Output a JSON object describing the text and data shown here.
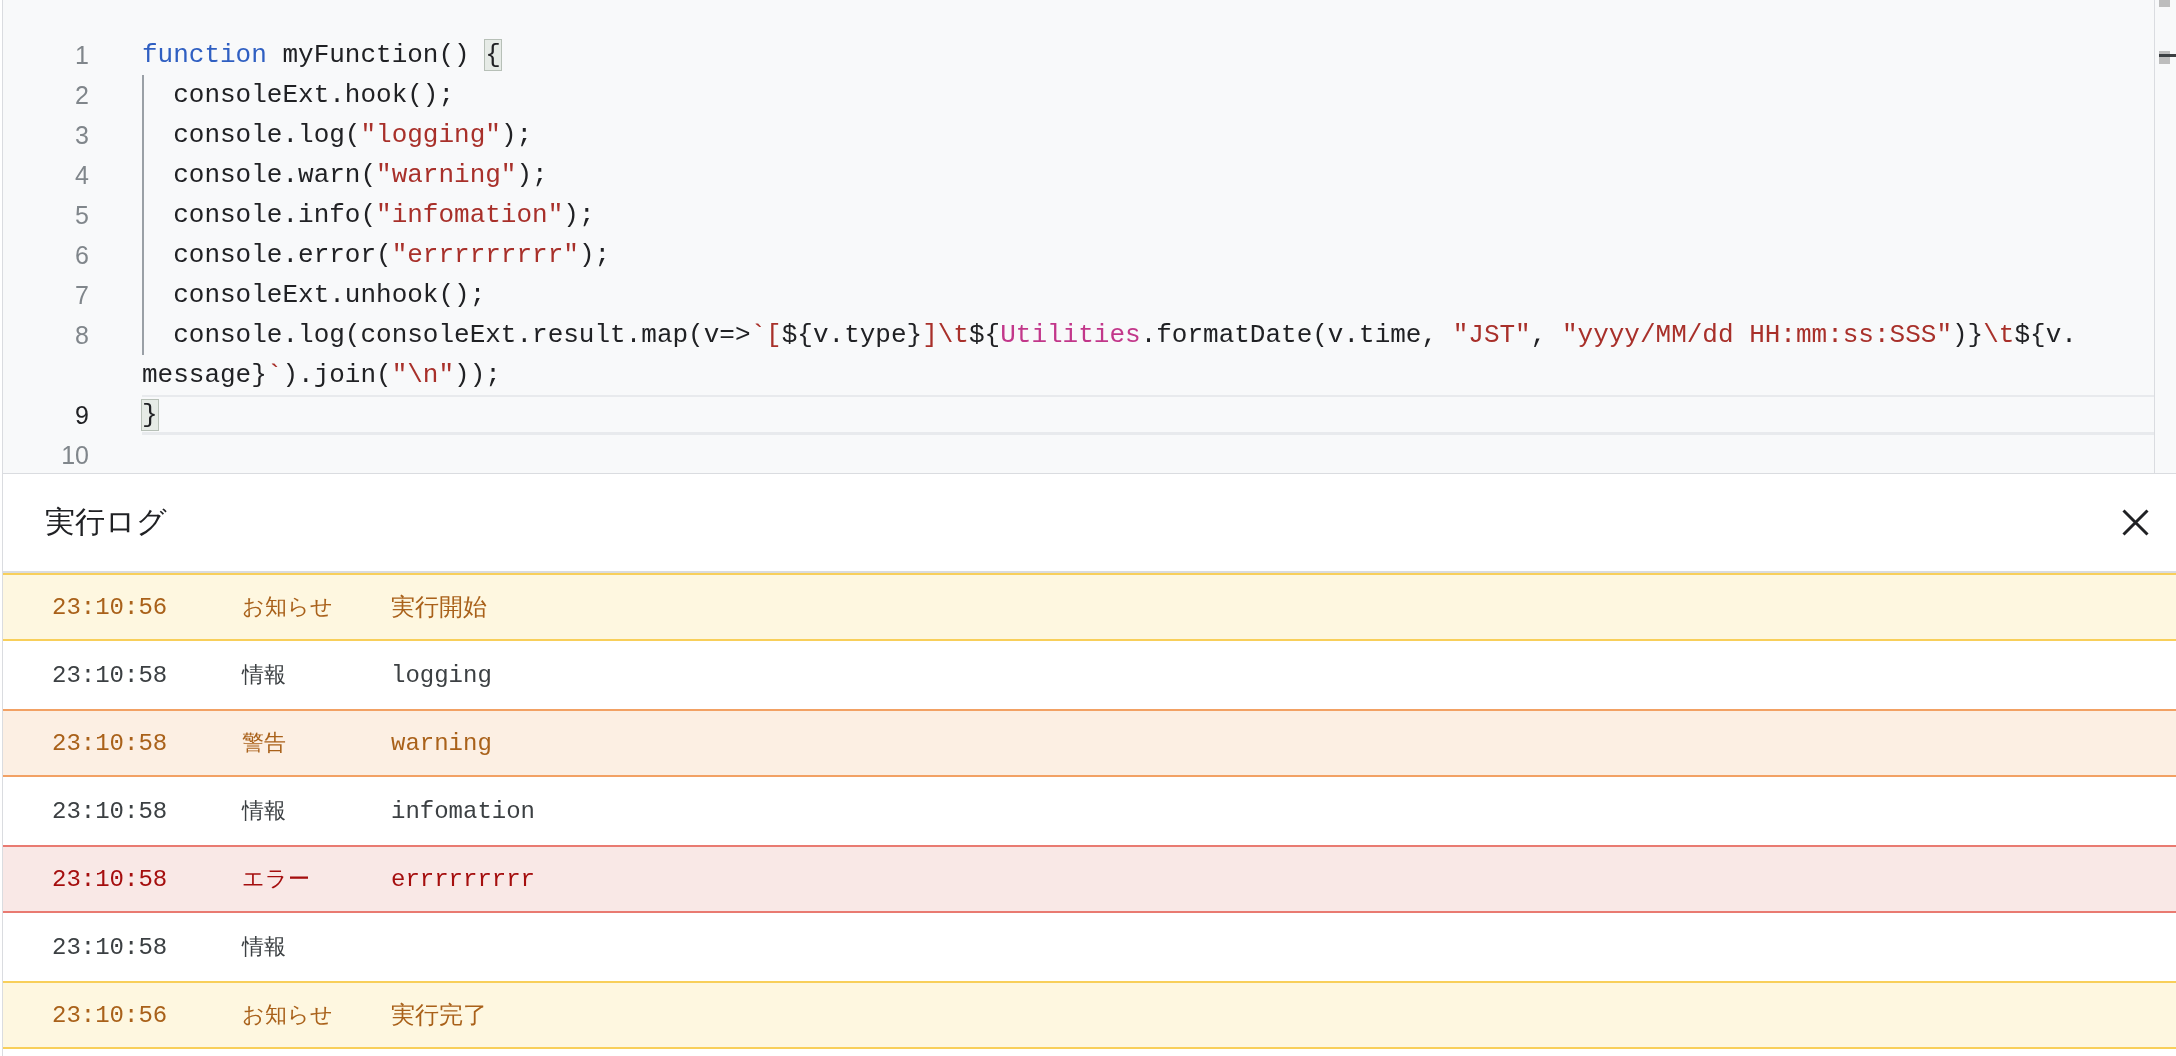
{
  "editor": {
    "lines": [
      {
        "number": "1",
        "current": false,
        "indented": false,
        "tokens": [
          {
            "kind": "keyword",
            "text": "function"
          },
          {
            "kind": "plain",
            "text": " myFunction() "
          },
          {
            "kind": "matched_bracket",
            "text": "{"
          }
        ]
      },
      {
        "number": "2",
        "current": false,
        "indented": true,
        "tokens": [
          {
            "kind": "plain",
            "text": "  consoleExt.hook();"
          }
        ]
      },
      {
        "number": "3",
        "current": false,
        "indented": true,
        "tokens": [
          {
            "kind": "plain",
            "text": "  console.log("
          },
          {
            "kind": "string",
            "text": "\"logging\""
          },
          {
            "kind": "plain",
            "text": ");"
          }
        ]
      },
      {
        "number": "4",
        "current": false,
        "indented": true,
        "tokens": [
          {
            "kind": "plain",
            "text": "  console.warn("
          },
          {
            "kind": "string",
            "text": "\"warning\""
          },
          {
            "kind": "plain",
            "text": ");"
          }
        ]
      },
      {
        "number": "5",
        "current": false,
        "indented": true,
        "tokens": [
          {
            "kind": "plain",
            "text": "  console.info("
          },
          {
            "kind": "string",
            "text": "\"infomation\""
          },
          {
            "kind": "plain",
            "text": ");"
          }
        ]
      },
      {
        "number": "6",
        "current": false,
        "indented": true,
        "tokens": [
          {
            "kind": "plain",
            "text": "  console.error("
          },
          {
            "kind": "string",
            "text": "\"errrrrrrrr\""
          },
          {
            "kind": "plain",
            "text": ");"
          }
        ]
      },
      {
        "number": "7",
        "current": false,
        "indented": true,
        "tokens": [
          {
            "kind": "plain",
            "text": "  consoleExt.unhook();"
          }
        ]
      },
      {
        "number": "8",
        "current": false,
        "indented": true,
        "tokens": [
          {
            "kind": "plain",
            "text": "  console.log(consoleExt.result.map(v=>"
          },
          {
            "kind": "string",
            "text": "`["
          },
          {
            "kind": "plain",
            "text": "${v.type}"
          },
          {
            "kind": "string",
            "text": "]\\t"
          },
          {
            "kind": "plain",
            "text": "${"
          },
          {
            "kind": "class",
            "text": "Utilities"
          },
          {
            "kind": "plain",
            "text": ".formatDate(v.time, "
          },
          {
            "kind": "string",
            "text": "\"JST\""
          },
          {
            "kind": "plain",
            "text": ", "
          },
          {
            "kind": "string",
            "text": "\"yyyy/MM/dd HH:mm:ss:SSS\""
          },
          {
            "kind": "plain",
            "text": ")}"
          },
          {
            "kind": "string",
            "text": "\\t"
          },
          {
            "kind": "plain",
            "text": "${v."
          }
        ],
        "wrap_tokens": [
          {
            "kind": "plain",
            "text": "message}"
          },
          {
            "kind": "string",
            "text": "`"
          },
          {
            "kind": "plain",
            "text": ").join("
          },
          {
            "kind": "string",
            "text": "\"\\n\""
          },
          {
            "kind": "plain",
            "text": "));"
          }
        ]
      },
      {
        "number": "9",
        "current": true,
        "indented": false,
        "tokens": [
          {
            "kind": "matched_bracket",
            "text": "}"
          }
        ]
      },
      {
        "number": "10",
        "current": false
      }
    ]
  },
  "log_panel": {
    "title": "実行ログ",
    "entries": [
      {
        "kind": "notice",
        "time": "23:10:56",
        "type": "お知らせ",
        "message": "実行開始"
      },
      {
        "kind": "info",
        "time": "23:10:58",
        "type": "情報",
        "message": "logging"
      },
      {
        "kind": "warning",
        "time": "23:10:58",
        "type": "警告",
        "message": "warning"
      },
      {
        "kind": "info",
        "time": "23:10:58",
        "type": "情報",
        "message": "infomation"
      },
      {
        "kind": "error",
        "time": "23:10:58",
        "type": "エラー",
        "message": "errrrrrrrr"
      },
      {
        "kind": "info",
        "time": "23:10:58",
        "type": "情報"
      },
      {
        "kind": "notice",
        "time": "23:10:56",
        "type": "お知らせ",
        "message": "実行完了"
      }
    ]
  }
}
